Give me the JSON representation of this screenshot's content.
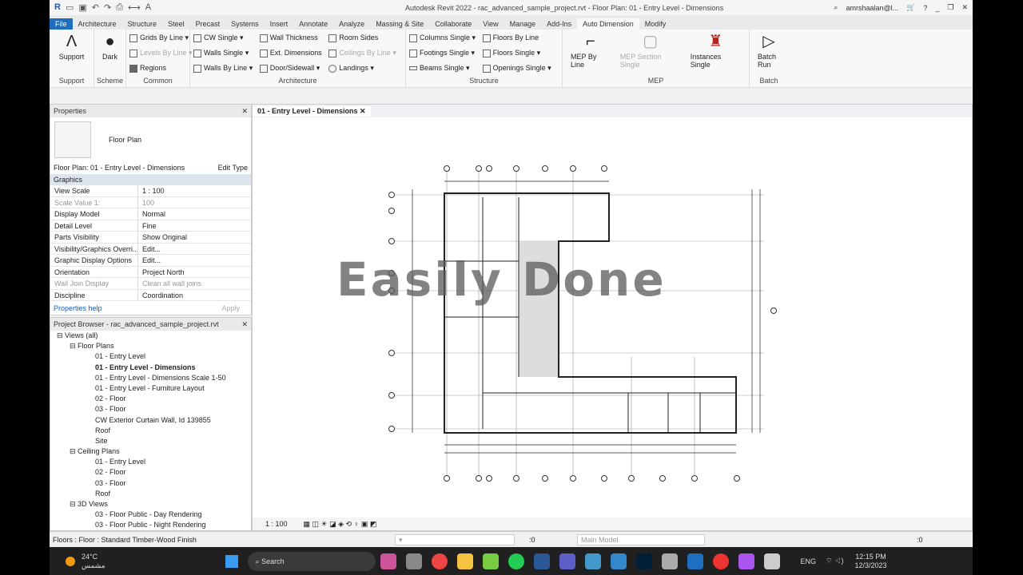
{
  "title": "Autodesk Revit 2022 - rac_advanced_sample_project.rvt - Floor Plan: 01 - Entry Level - Dimensions",
  "user": "amrshaalan@l...",
  "tabs": [
    "File",
    "Architecture",
    "Structure",
    "Steel",
    "Precast",
    "Systems",
    "Insert",
    "Annotate",
    "Analyze",
    "Massing & Site",
    "Collaborate",
    "View",
    "Manage",
    "Add-Ins",
    "Auto Dimension",
    "Modify"
  ],
  "ribbon": {
    "support": {
      "btn": "Support",
      "label": "Support"
    },
    "scheme": {
      "btn": "Dark",
      "label": "Scheme"
    },
    "common": {
      "items": [
        "Grids By Line",
        "Levels By Line",
        "Regions"
      ],
      "label": "Common"
    },
    "architecture": {
      "col1": [
        "CW Single",
        "Walls Single",
        "Walls By Line"
      ],
      "col2": [
        "Wall Thickness",
        "Ext. Dimensions",
        "Door/Sidewall"
      ],
      "col3": [
        "Room Sides",
        "Ceilings By Line",
        "Landings"
      ],
      "label": "Architecture"
    },
    "structure": {
      "col1": [
        "Columns Single",
        "Footings Single",
        "Beams Single"
      ],
      "col2": [
        "Floors By Line",
        "Floors Single",
        "Openings Single"
      ],
      "label": "Structure"
    },
    "mep": {
      "items": [
        "MEP By Line",
        "MEP Section Single",
        "Instances Single"
      ],
      "label": "MEP"
    },
    "batch": {
      "btn": "Batch Run",
      "label": "Batch"
    }
  },
  "properties": {
    "header": "Properties",
    "type": "Floor Plan",
    "selector": "Floor Plan: 01 - Entry Level - Dimensions",
    "edit_type": "Edit Type",
    "section": "Graphics",
    "rows": [
      [
        "View Scale",
        "1 : 100"
      ],
      [
        "Scale Value    1:",
        "100"
      ],
      [
        "Display Model",
        "Normal"
      ],
      [
        "Detail Level",
        "Fine"
      ],
      [
        "Parts Visibility",
        "Show Original"
      ],
      [
        "Visibility/Graphics Overri...",
        "Edit..."
      ],
      [
        "Graphic Display Options",
        "Edit..."
      ],
      [
        "Orientation",
        "Project North"
      ],
      [
        "Wall Join Display",
        "Clean all wall joins"
      ],
      [
        "Discipline",
        "Coordination"
      ]
    ],
    "help": "Properties help",
    "apply": "Apply"
  },
  "browser": {
    "header": "Project Browser - rac_advanced_sample_project.rvt",
    "items": [
      [
        "Views (all)",
        0
      ],
      [
        "Floor Plans",
        1
      ],
      [
        "01 - Entry Level",
        2
      ],
      [
        "01 - Entry Level - Dimensions",
        2
      ],
      [
        "01 - Entry Level - Dimensions Scale 1-50",
        2
      ],
      [
        "01 - Entry Level - Furniture Layout",
        2
      ],
      [
        "02 - Floor",
        2
      ],
      [
        "03 - Floor",
        2
      ],
      [
        "CW Exterior Curtain Wall, Id 139855",
        2
      ],
      [
        "Roof",
        2
      ],
      [
        "Site",
        2
      ],
      [
        "Ceiling Plans",
        1
      ],
      [
        "01 - Entry Level",
        2
      ],
      [
        "02 - Floor",
        2
      ],
      [
        "03 - Floor",
        2
      ],
      [
        "Roof",
        2
      ],
      [
        "3D Views",
        1
      ],
      [
        "03 - Floor Public - Day Rendering",
        2
      ],
      [
        "03 - Floor Public - Night Rendering",
        2
      ]
    ]
  },
  "view": {
    "tab": "01 - Entry Level - Dimensions",
    "watermark": "Easily Done",
    "scale": "1 : 100"
  },
  "status": {
    "text": "Floors : Floor : Standard Timber-Wood Finish",
    "count": ":0",
    "model": "Main Model",
    "filter": ":0"
  },
  "taskbar": {
    "temp": "24°C",
    "weather": "مشمس",
    "search": "Search",
    "lang": "ENG",
    "time": "12:15 PM",
    "date": "12/3/2023"
  }
}
